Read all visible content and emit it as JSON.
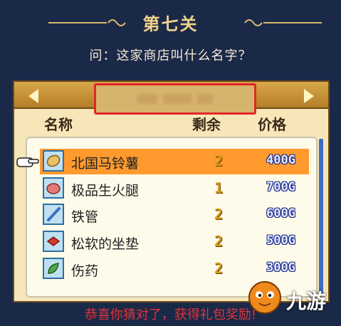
{
  "level": {
    "title": "第七关"
  },
  "question": "问：这家商店叫什么名字？",
  "shop": {
    "name_blurred": true
  },
  "columns": {
    "name": "名称",
    "remaining": "剩余",
    "price": "价格"
  },
  "items": [
    {
      "name": "北国马铃薯",
      "qty": "2",
      "price": "400G",
      "icon": "potato-icon",
      "selected": true
    },
    {
      "name": "极品生火腿",
      "qty": "1",
      "price": "700G",
      "icon": "ham-icon",
      "selected": false
    },
    {
      "name": "铁管",
      "qty": "2",
      "price": "600G",
      "icon": "iron-pipe-icon",
      "selected": false
    },
    {
      "name": "松软的坐垫",
      "qty": "2",
      "price": "500G",
      "icon": "cushion-icon",
      "selected": false
    },
    {
      "name": "伤药",
      "qty": "2",
      "price": "300G",
      "icon": "herb-medicine-icon",
      "selected": false
    }
  ],
  "footer": "恭喜你猜对了，获得礼包奖励!",
  "watermark": "九游",
  "colors": {
    "background": "#1b2948",
    "title": "#f0d28b",
    "selected_row": "#ff9a2e",
    "highlight_box": "#e22727",
    "footer": "#e0343a"
  }
}
